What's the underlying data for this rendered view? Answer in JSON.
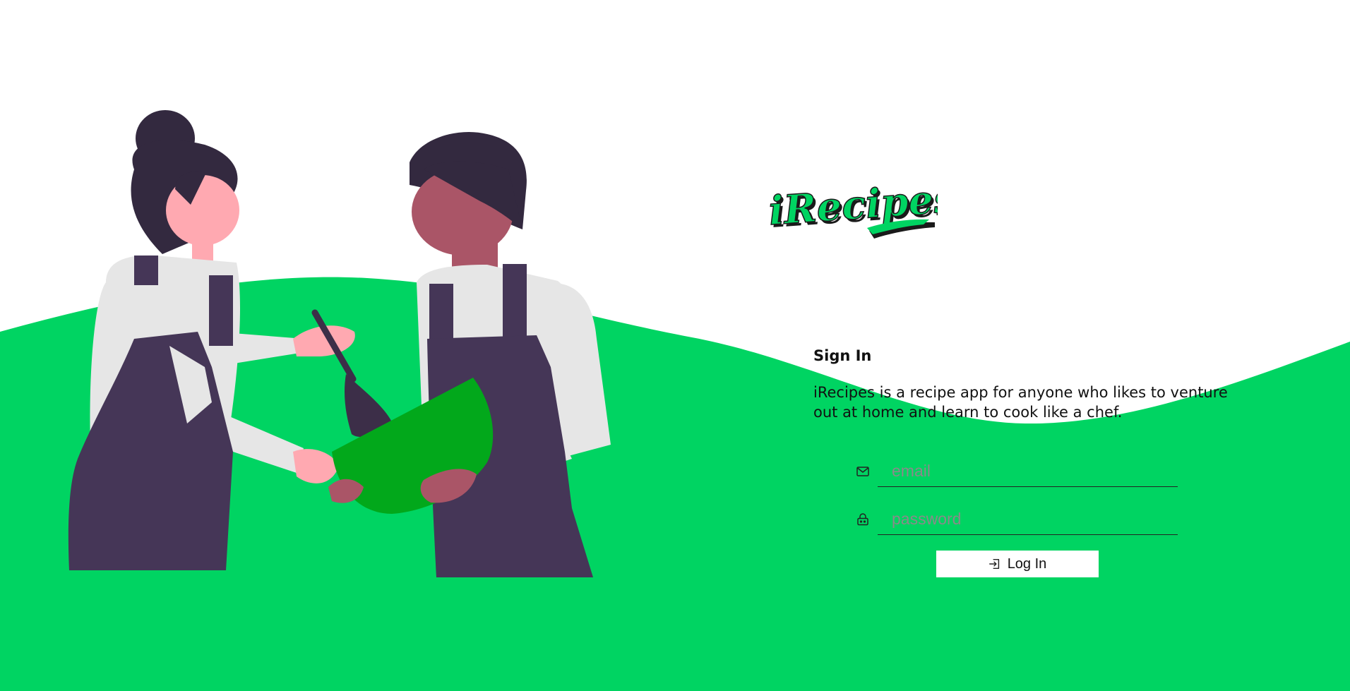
{
  "app": {
    "logo_text": "iRecipes"
  },
  "signin": {
    "title": "Sign In",
    "description": "iRecipes is a recipe app for anyone who likes to venture out at home and learn to cook like a chef."
  },
  "form": {
    "email_placeholder": "email",
    "password_placeholder": "password",
    "login_label": "Log In"
  },
  "icons": {
    "email": "mail-icon",
    "password": "lock-icon",
    "login": "login-icon"
  },
  "colors": {
    "brand_green": "#00d462",
    "bowl_green": "#02a81b",
    "dark_purple": "#453657",
    "hair": "#33293f",
    "skin_light": "#ffa9b1",
    "skin_dark": "#aa5567",
    "shirt": "#e6e6e6"
  }
}
